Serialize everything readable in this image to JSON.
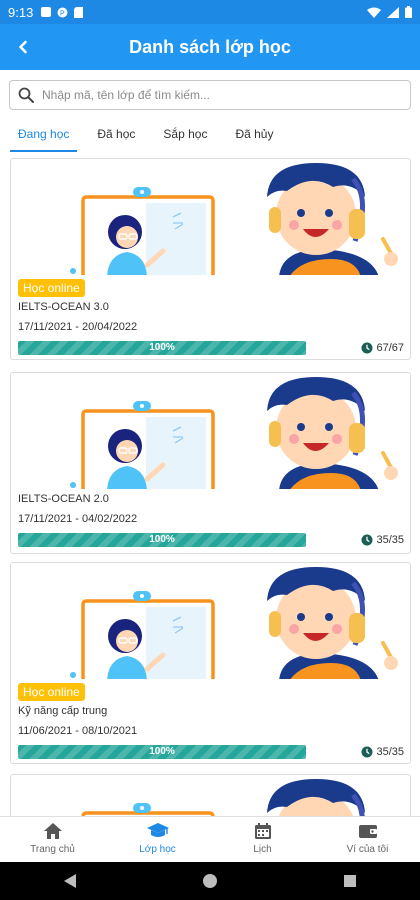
{
  "status_bar": {
    "time": "9:13"
  },
  "header": {
    "title": "Danh sách lớp học"
  },
  "search": {
    "placeholder": "Nhập mã, tên lớp để tìm kiếm..."
  },
  "tabs": [
    {
      "label": "Đang học",
      "active": true
    },
    {
      "label": "Đã học",
      "active": false
    },
    {
      "label": "Sắp học",
      "active": false
    },
    {
      "label": "Đã hủy",
      "active": false
    }
  ],
  "classes": [
    {
      "badge": "Học online",
      "name": "IELTS-OCEAN 3.0",
      "dates": "17/11/2021 - 20/04/2022",
      "progress_text": "100%",
      "progress": 1.0,
      "count": "67/67"
    },
    {
      "badge": "",
      "name": "IELTS-OCEAN 2.0",
      "dates": "17/11/2021 - 04/02/2022",
      "progress_text": "100%",
      "progress": 1.0,
      "count": "35/35"
    },
    {
      "badge": "Học online",
      "name": "Kỹ năng cấp trung",
      "dates": "11/06/2021 - 08/10/2021",
      "progress_text": "100%",
      "progress": 1.0,
      "count": "35/35"
    }
  ],
  "bottom_nav": [
    {
      "label": "Trang chủ",
      "icon": "home-icon",
      "active": false
    },
    {
      "label": "Lớp học",
      "icon": "graduation-cap-icon",
      "active": true
    },
    {
      "label": "Lịch",
      "icon": "calendar-icon",
      "active": false
    },
    {
      "label": "Ví của tôi",
      "icon": "wallet-icon",
      "active": false
    }
  ],
  "colors": {
    "primary": "#2196f3",
    "badge": "#ffc107",
    "progress": "#26a69a"
  }
}
